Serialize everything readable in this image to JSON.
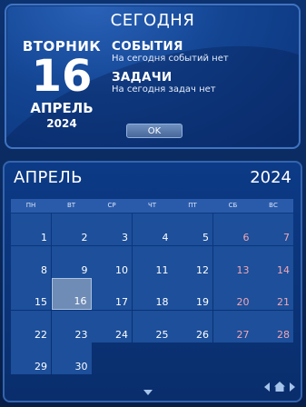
{
  "today": {
    "title": "СЕГОДНЯ",
    "weekday": "ВТОРНИК",
    "day": "16",
    "month": "АПРЕЛЬ",
    "year": "2024",
    "events_heading": "СОБЫТИЯ",
    "events_text": "На сегодня событий нет",
    "tasks_heading": "ЗАДАЧИ",
    "tasks_text": "На сегодня задач нет",
    "ok_label": "OK"
  },
  "calendar": {
    "month": "АПРЕЛЬ",
    "year": "2024",
    "weekdays": [
      "ПН",
      "ВТ",
      "СР",
      "ЧТ",
      "ПТ",
      "СБ",
      "ВС"
    ],
    "leading_blanks": 0,
    "days": [
      "1",
      "2",
      "3",
      "4",
      "5",
      "6",
      "7",
      "8",
      "9",
      "10",
      "11",
      "12",
      "13",
      "14",
      "15",
      "16",
      "17",
      "18",
      "19",
      "20",
      "21",
      "22",
      "23",
      "24",
      "25",
      "26",
      "27",
      "28",
      "29",
      "30"
    ],
    "today": "16"
  },
  "colors": {
    "weekend": "#f0a7b6",
    "today_cell": "#6f8cb6",
    "day_cell": "#1d4f9a"
  },
  "icons": {
    "expand": "chevron-down-icon",
    "prev": "arrow-left-icon",
    "home": "home-icon",
    "next": "arrow-right-icon"
  }
}
